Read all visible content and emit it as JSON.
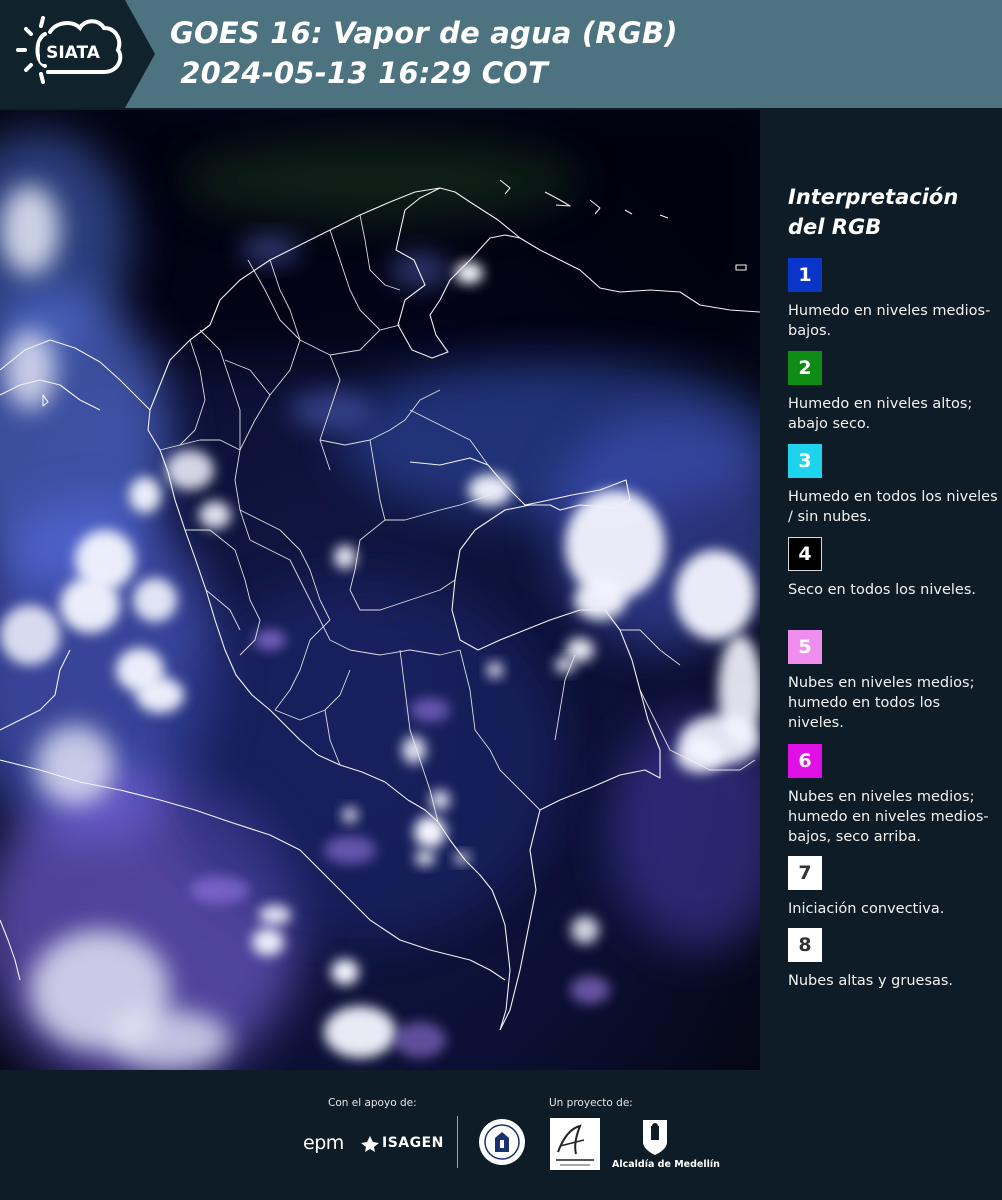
{
  "header": {
    "logo_text": "SIATA",
    "title_line1": "GOES 16: Vapor de agua (RGB)",
    "title_line2": " 2024-05-13 16:29 COT"
  },
  "legend": {
    "title": "Interpretación del RGB",
    "items": [
      {
        "number": "1",
        "color": "#0a35c9",
        "text": "Humedo en niveles medios-bajos."
      },
      {
        "number": "2",
        "color": "#0f8c15",
        "text": "Humedo en niveles altos; abajo seco."
      },
      {
        "number": "3",
        "color": "#1ed3ee",
        "text": "Humedo en todos los niveles / sin nubes."
      },
      {
        "number": "4",
        "color": "#000000",
        "text": "Seco en todos los niveles."
      },
      {
        "number": "5",
        "color": "#f08ef0",
        "text": "Nubes en niveles medios; humedo en todos los niveles."
      },
      {
        "number": "6",
        "color": "#e00fe6",
        "text": "Nubes en niveles medios; humedo en niveles medios-bajos, seco arriba."
      },
      {
        "number": "7",
        "color": "#ffffff",
        "text": "Iniciación convectiva."
      },
      {
        "number": "8",
        "color": "#ffffff",
        "text": "Nubes altas y gruesas."
      }
    ]
  },
  "footer": {
    "support_label": "Con el apoyo de:",
    "project_label": "Un proyecto de:",
    "sponsors": [
      "epm",
      "ISAGEN"
    ],
    "partners": [
      "Alcaldía de Medellín"
    ]
  }
}
